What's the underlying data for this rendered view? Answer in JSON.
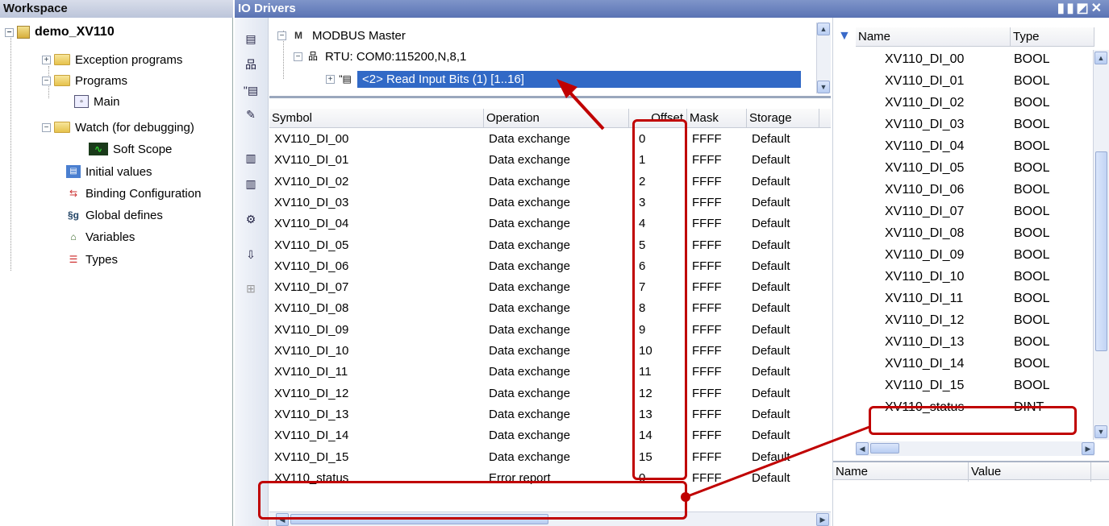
{
  "workspace": {
    "title": "Workspace",
    "project": "demo_XV110",
    "items": [
      {
        "label": "Exception programs"
      },
      {
        "label": "Programs"
      },
      {
        "label": "Main"
      },
      {
        "label": "Watch (for debugging)"
      },
      {
        "label": "Soft Scope"
      },
      {
        "label": "Initial values"
      },
      {
        "label": "Binding Configuration"
      },
      {
        "label": "Global defines"
      },
      {
        "label": "Variables"
      },
      {
        "label": "Types"
      }
    ]
  },
  "io": {
    "title": "IO Drivers",
    "tree": {
      "master": "MODBUS Master",
      "rtu": "RTU: COM0:115200,N,8,1",
      "block": "<2> Read Input Bits (1) [1..16]"
    },
    "columns": [
      "Symbol",
      "Operation",
      "Offset",
      "Mask",
      "Storage"
    ],
    "rows": [
      {
        "symbol": "XV110_DI_00",
        "operation": "Data exchange",
        "offset": "0",
        "mask": "FFFF",
        "storage": "Default"
      },
      {
        "symbol": "XV110_DI_01",
        "operation": "Data exchange",
        "offset": "1",
        "mask": "FFFF",
        "storage": "Default"
      },
      {
        "symbol": "XV110_DI_02",
        "operation": "Data exchange",
        "offset": "2",
        "mask": "FFFF",
        "storage": "Default"
      },
      {
        "symbol": "XV110_DI_03",
        "operation": "Data exchange",
        "offset": "3",
        "mask": "FFFF",
        "storage": "Default"
      },
      {
        "symbol": "XV110_DI_04",
        "operation": "Data exchange",
        "offset": "4",
        "mask": "FFFF",
        "storage": "Default"
      },
      {
        "symbol": "XV110_DI_05",
        "operation": "Data exchange",
        "offset": "5",
        "mask": "FFFF",
        "storage": "Default"
      },
      {
        "symbol": "XV110_DI_06",
        "operation": "Data exchange",
        "offset": "6",
        "mask": "FFFF",
        "storage": "Default"
      },
      {
        "symbol": "XV110_DI_07",
        "operation": "Data exchange",
        "offset": "7",
        "mask": "FFFF",
        "storage": "Default"
      },
      {
        "symbol": "XV110_DI_08",
        "operation": "Data exchange",
        "offset": "8",
        "mask": "FFFF",
        "storage": "Default"
      },
      {
        "symbol": "XV110_DI_09",
        "operation": "Data exchange",
        "offset": "9",
        "mask": "FFFF",
        "storage": "Default"
      },
      {
        "symbol": "XV110_DI_10",
        "operation": "Data exchange",
        "offset": "10",
        "mask": "FFFF",
        "storage": "Default"
      },
      {
        "symbol": "XV110_DI_11",
        "operation": "Data exchange",
        "offset": "11",
        "mask": "FFFF",
        "storage": "Default"
      },
      {
        "symbol": "XV110_DI_12",
        "operation": "Data exchange",
        "offset": "12",
        "mask": "FFFF",
        "storage": "Default"
      },
      {
        "symbol": "XV110_DI_13",
        "operation": "Data exchange",
        "offset": "13",
        "mask": "FFFF",
        "storage": "Default"
      },
      {
        "symbol": "XV110_DI_14",
        "operation": "Data exchange",
        "offset": "14",
        "mask": "FFFF",
        "storage": "Default"
      },
      {
        "symbol": "XV110_DI_15",
        "operation": "Data exchange",
        "offset": "15",
        "mask": "FFFF",
        "storage": "Default"
      },
      {
        "symbol": "XV110_status",
        "operation": "Error report",
        "offset": "0",
        "mask": "FFFF",
        "storage": "Default"
      }
    ]
  },
  "variables": {
    "columns": [
      "Name",
      "Type"
    ],
    "rows": [
      {
        "name": "XV110_DI_00",
        "type": "BOOL"
      },
      {
        "name": "XV110_DI_01",
        "type": "BOOL"
      },
      {
        "name": "XV110_DI_02",
        "type": "BOOL"
      },
      {
        "name": "XV110_DI_03",
        "type": "BOOL"
      },
      {
        "name": "XV110_DI_04",
        "type": "BOOL"
      },
      {
        "name": "XV110_DI_05",
        "type": "BOOL"
      },
      {
        "name": "XV110_DI_06",
        "type": "BOOL"
      },
      {
        "name": "XV110_DI_07",
        "type": "BOOL"
      },
      {
        "name": "XV110_DI_08",
        "type": "BOOL"
      },
      {
        "name": "XV110_DI_09",
        "type": "BOOL"
      },
      {
        "name": "XV110_DI_10",
        "type": "BOOL"
      },
      {
        "name": "XV110_DI_11",
        "type": "BOOL"
      },
      {
        "name": "XV110_DI_12",
        "type": "BOOL"
      },
      {
        "name": "XV110_DI_13",
        "type": "BOOL"
      },
      {
        "name": "XV110_DI_14",
        "type": "BOOL"
      },
      {
        "name": "XV110_DI_15",
        "type": "BOOL"
      },
      {
        "name": "XV110_status",
        "type": "DINT"
      }
    ],
    "props_columns": [
      "Name",
      "Value"
    ]
  },
  "colors": {
    "annotation": "#c00000",
    "selection": "#3169c6",
    "titlebar": "#5a73b4"
  }
}
